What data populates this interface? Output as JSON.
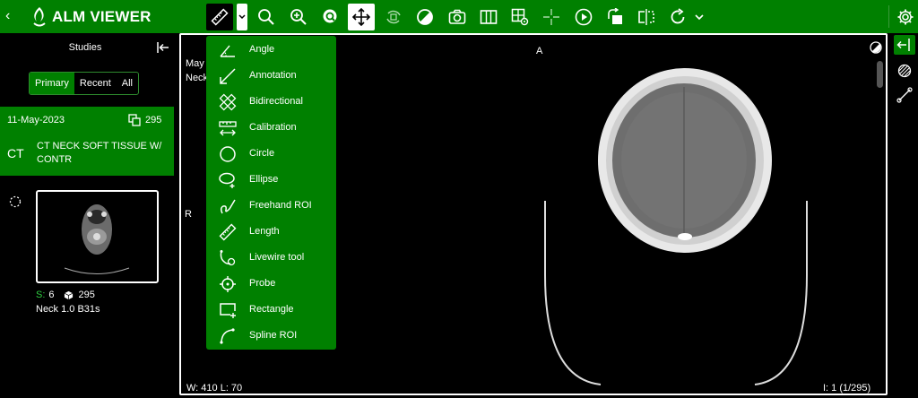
{
  "app": {
    "brand": "ALM VIEWER"
  },
  "toolbar": {
    "tools": [
      {
        "name": "measure-tool-button",
        "icon": "ruler-icon",
        "active": true
      },
      {
        "name": "zoom-button",
        "icon": "magnifier-icon"
      },
      {
        "name": "zoom-in-button",
        "icon": "zoom-in-icon"
      },
      {
        "name": "zoom-fit-button",
        "icon": "zoom-fit-icon"
      },
      {
        "name": "pan-button",
        "icon": "move-arrows-icon",
        "selected": true
      },
      {
        "name": "rotate-3d-button",
        "icon": "rotate-3d-icon"
      },
      {
        "name": "contrast-button",
        "icon": "contrast-icon"
      },
      {
        "name": "capture-button",
        "icon": "camera-icon"
      },
      {
        "name": "layout-button",
        "icon": "layout-icon"
      },
      {
        "name": "layout-settings-button",
        "icon": "grid-gear-icon"
      },
      {
        "name": "crosshair-button",
        "icon": "crosshair-icon"
      },
      {
        "name": "cine-button",
        "icon": "play-icon"
      },
      {
        "name": "rotate-button",
        "icon": "rotate-icon"
      },
      {
        "name": "flip-button",
        "icon": "flip-icon"
      },
      {
        "name": "reset-button",
        "icon": "refresh-icon"
      },
      {
        "name": "more-button",
        "icon": "chevron-down-icon"
      }
    ]
  },
  "sidebar": {
    "title": "Studies",
    "tabs": [
      "Primary",
      "Recent",
      "All"
    ],
    "active_tab": "Primary",
    "study": {
      "date": "11-May-2023",
      "count": "295",
      "modality": "CT",
      "description": "CT NECK SOFT TISSUE W/ CONTR"
    },
    "series": {
      "s_label": "S:",
      "s_number": "6",
      "image_count": "295",
      "description": "Neck 1.0 B31s"
    }
  },
  "viewport": {
    "top_left_line1": "May",
    "top_left_line2": "Neck",
    "orientation_top": "A",
    "orientation_left": "R",
    "window": "W:  410  L:  70",
    "image_index": "I: 1 (1/295)"
  },
  "measure_menu": {
    "items": [
      {
        "label": "Angle",
        "icon": "angle-icon"
      },
      {
        "label": "Annotation",
        "icon": "arrow-annotation-icon"
      },
      {
        "label": "Bidirectional",
        "icon": "bidirectional-ruler-icon"
      },
      {
        "label": "Calibration",
        "icon": "calibration-icon"
      },
      {
        "label": "Circle",
        "icon": "circle-icon"
      },
      {
        "label": "Ellipse",
        "icon": "ellipse-icon"
      },
      {
        "label": "Freehand ROI",
        "icon": "freehand-icon"
      },
      {
        "label": "Length",
        "icon": "ruler-icon"
      },
      {
        "label": "Livewire tool",
        "icon": "livewire-icon"
      },
      {
        "label": "Probe",
        "icon": "probe-icon"
      },
      {
        "label": "Rectangle",
        "icon": "rectangle-icon"
      },
      {
        "label": "Spline ROI",
        "icon": "spline-icon"
      }
    ]
  },
  "colors": {
    "brand_green": "#008000",
    "background": "#000000"
  }
}
